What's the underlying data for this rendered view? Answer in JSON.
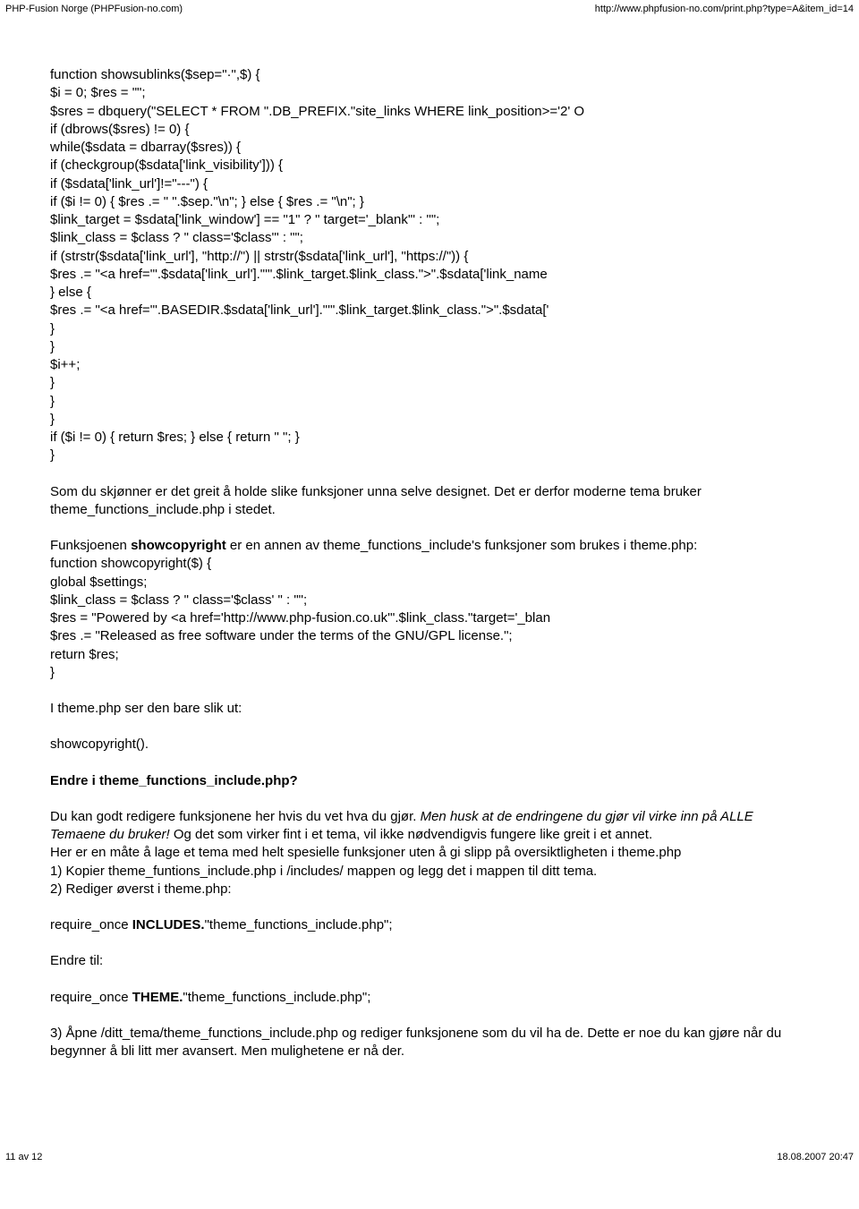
{
  "header": {
    "site_title": "PHP-Fusion Norge (PHPFusion-no.com)",
    "url": "http://www.phpfusion-no.com/print.php?type=A&item_id=14"
  },
  "code1": "function showsublinks($sep=\"·\",$) {\n$i = 0; $res = \"\";\n$sres = dbquery(\"SELECT * FROM \".DB_PREFIX.\"site_links WHERE link_position>='2' O\nif (dbrows($sres) != 0) {\nwhile($sdata = dbarray($sres)) {\nif (checkgroup($sdata['link_visibility'])) {\nif ($sdata['link_url']!=\"---\") {\nif ($i != 0) { $res .= \" \".$sep.\"\\n\"; } else { $res .= \"\\n\"; }\n$link_target = $sdata['link_window'] == \"1\" ? \" target='_blank'\" : \"\";\n$link_class = $class ? \" class='$class'\" : \"\";\nif (strstr($sdata['link_url'], \"http://\") || strstr($sdata['link_url'], \"https://\")) {\n$res .= \"<a href='\".$sdata['link_url'].\"'\".$link_target.$link_class.\">\".$sdata['link_name\n} else {\n$res .= \"<a href='\".BASEDIR.$sdata['link_url'].\"'\".$link_target.$link_class.\">\".$sdata['\n}\n}\n$i++;\n}\n}\n}\nif ($i != 0) { return $res; } else { return \" \"; }\n}",
  "para1": "Som du skjønner er det greit å holde slike funksjoner unna selve designet. Det er derfor moderne tema bruker theme_functions_include.php i stedet.",
  "para2": {
    "before": "Funksjoenen ",
    "bold": "showcopyright",
    "after": " er en annen av theme_functions_include's funksjoner som brukes i theme.php:"
  },
  "code2": "function showcopyright($) {\nglobal $settings;\n$link_class = $class ? \" class='$class' \" : \"\";\n$res = \"Powered by <a href='http://www.php-fusion.co.uk'\".$link_class.\"target='_blan\n$res .= \"Released as free software under the terms of the GNU/GPL license.\";\nreturn $res;\n}",
  "para3": "I theme.php ser den bare slik ut:",
  "para4": "showcopyright().",
  "heading1": "Endre i theme_functions_include.php?",
  "para5": {
    "line1_before": "Du kan godt redigere funksjonene her hvis du vet hva du gjør. ",
    "line1_italic": "Men husk at de endringene du gjør vil virke inn på ALLE Temaene du bruker!",
    "line1_after": " Og det som virker fint i et tema, vil ikke nødvendigvis fungere like greit i et annet.",
    "line2": "Her er en måte å lage et tema med helt spesielle funksjoner uten å gi slipp på oversiktligheten i theme.php",
    "line3": "1) Kopier theme_funtions_include.php i /includes/ mappen og legg det i mappen til ditt tema.",
    "line4": "2) Rediger øverst i theme.php:"
  },
  "req1": {
    "before": "require_once ",
    "bold": "INCLUDES.",
    "after": "\"theme_functions_include.php\";"
  },
  "para6": "Endre til:",
  "req2": {
    "before": "require_once ",
    "bold": "THEME.",
    "after": "\"theme_functions_include.php\";"
  },
  "para7": "3) Åpne /ditt_tema/theme_functions_include.php og rediger funksjonene som du vil ha de. Dette er noe du kan gjøre når du begynner å bli litt mer avansert. Men mulighetene er nå der.",
  "footer": {
    "page_count": "11 av 12",
    "timestamp": "18.08.2007 20:47"
  }
}
